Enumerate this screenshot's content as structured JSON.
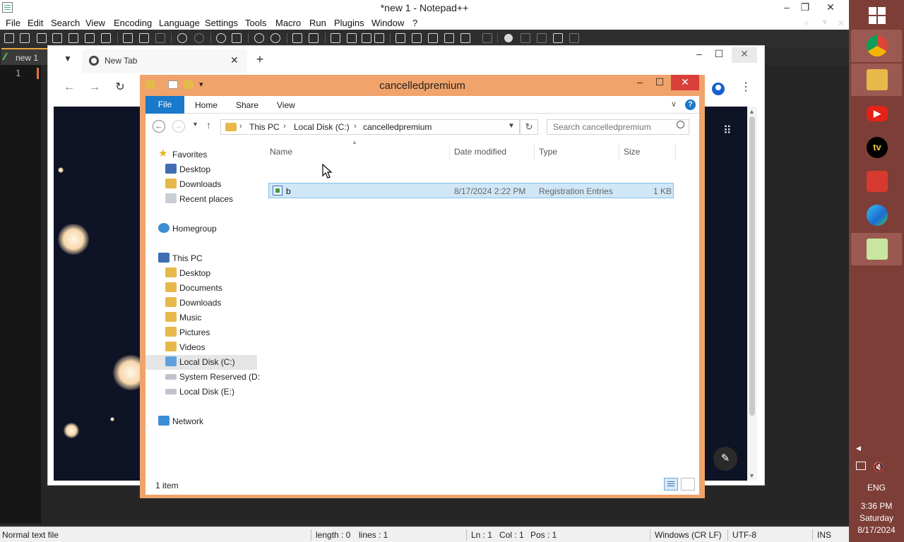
{
  "notepad": {
    "title": "*new 1 - Notepad++",
    "menu": [
      "File",
      "Edit",
      "Search",
      "View",
      "Encoding",
      "Language",
      "Settings",
      "Tools",
      "Macro",
      "Run",
      "Plugins",
      "Window",
      "?"
    ],
    "tab": "new 1",
    "line_number": "1",
    "status": {
      "file_type": "Normal text file",
      "length": "length : 0",
      "lines": "lines : 1",
      "ln": "Ln : 1",
      "col": "Col : 1",
      "pos": "Pos : 1",
      "eol": "Windows (CR LF)",
      "encoding": "UTF-8",
      "mode": "INS"
    },
    "window_controls": {
      "minimize": "–",
      "restore": "❐",
      "close": "✕"
    },
    "tab_controls": {
      "add": "+",
      "dropdown": "▼",
      "close": "✕"
    }
  },
  "chrome": {
    "tab_title": "New Tab",
    "tab_close": "✕",
    "new_tab": "+",
    "window_controls": {
      "minimize": "–",
      "maximize": "☐",
      "close": "✕"
    }
  },
  "explorer": {
    "title": "cancelledpremium",
    "ribbon_tabs": {
      "file": "File",
      "home": "Home",
      "share": "Share",
      "view": "View"
    },
    "help": "?",
    "breadcrumb": [
      "This PC",
      "Local Disk (C:)",
      "cancelledpremium"
    ],
    "search_placeholder": "Search cancelledpremium",
    "nav": {
      "favorites": "Favorites",
      "fav_desktop": "Desktop",
      "fav_downloads": "Downloads",
      "fav_recent": "Recent places",
      "homegroup": "Homegroup",
      "this_pc": "This PC",
      "pc_desktop": "Desktop",
      "pc_documents": "Documents",
      "pc_downloads": "Downloads",
      "pc_music": "Music",
      "pc_pictures": "Pictures",
      "pc_videos": "Videos",
      "local_c": "Local Disk (C:)",
      "system_reserved": "System Reserved (D:",
      "local_e": "Local Disk (E:)",
      "network": "Network"
    },
    "columns": {
      "name": "Name",
      "date": "Date modified",
      "type": "Type",
      "size": "Size"
    },
    "files": [
      {
        "name": "b",
        "date": "8/17/2024 2:22 PM",
        "type": "Registration Entries",
        "size": "1 KB"
      }
    ],
    "item_count": "1 item",
    "colors": {
      "frame": "#f0a36b",
      "accent": "#1979ca",
      "selection": "#d0e7f7"
    }
  },
  "taskbar": {
    "language": "ENG",
    "time": "3:36 PM",
    "day": "Saturday",
    "date": "8/17/2024",
    "apps": [
      {
        "name": "Chrome",
        "icon": "chrome-icon"
      },
      {
        "name": "File Explorer",
        "icon": "folder-icon"
      },
      {
        "name": "YouTube",
        "icon": "youtube-icon"
      },
      {
        "name": "TV",
        "icon": "tv-icon",
        "label": "tv"
      },
      {
        "name": "App",
        "icon": "red-app-icon"
      },
      {
        "name": "Edge",
        "icon": "edge-icon"
      },
      {
        "name": "Notepad++",
        "icon": "notepadpp-icon"
      }
    ],
    "colors": {
      "background": "#7d3e38"
    }
  }
}
